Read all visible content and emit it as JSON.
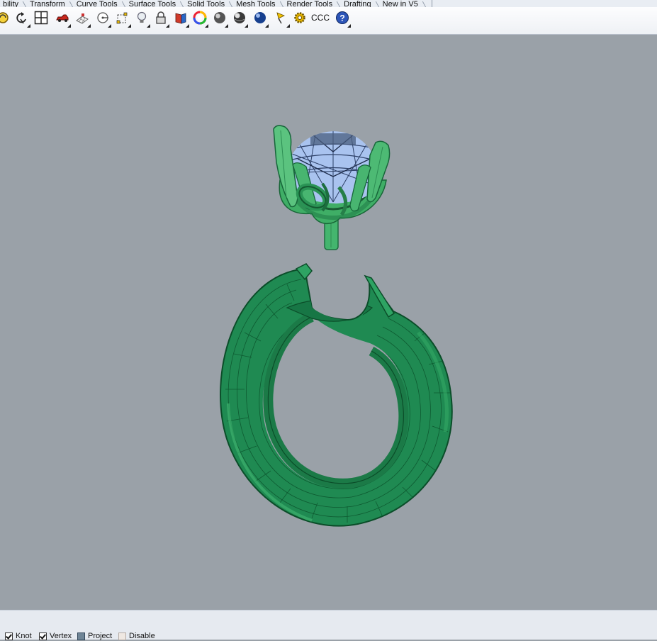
{
  "tabs": [
    {
      "label": "bility"
    },
    {
      "label": "Transform"
    },
    {
      "label": "Curve Tools"
    },
    {
      "label": "Surface Tools"
    },
    {
      "label": "Solid Tools"
    },
    {
      "label": "Mesh Tools"
    },
    {
      "label": "Render Tools"
    },
    {
      "label": "Drafting"
    },
    {
      "label": "New in V5"
    }
  ],
  "toolbar": {
    "icons": [
      "rotate-view-icon",
      "undo-view-icon",
      "four-viewports-icon",
      "car-icon",
      "grid-plane-icon",
      "point-target-icon",
      "snap-select-icon",
      "light-bulb-icon",
      "padlock-icon",
      "layer-book-icon",
      "color-wheel-icon",
      "shade-sphere-icon",
      "rendered-sphere-icon",
      "blue-sphere-icon",
      "pin-flag-icon",
      "gear-icon"
    ],
    "text_button": "CCC",
    "help_icon": "help-icon"
  },
  "viewport": {
    "background_color": "#9aa1a8",
    "object_color": "#2e9a5c",
    "gem_color": "#a9c3ef"
  },
  "statusbar": {
    "options": [
      {
        "label": "Knot",
        "checked": true
      },
      {
        "label": "Vertex",
        "checked": true
      },
      {
        "label": "Project",
        "checked": true
      },
      {
        "label": "Disable",
        "checked": false
      }
    ]
  }
}
